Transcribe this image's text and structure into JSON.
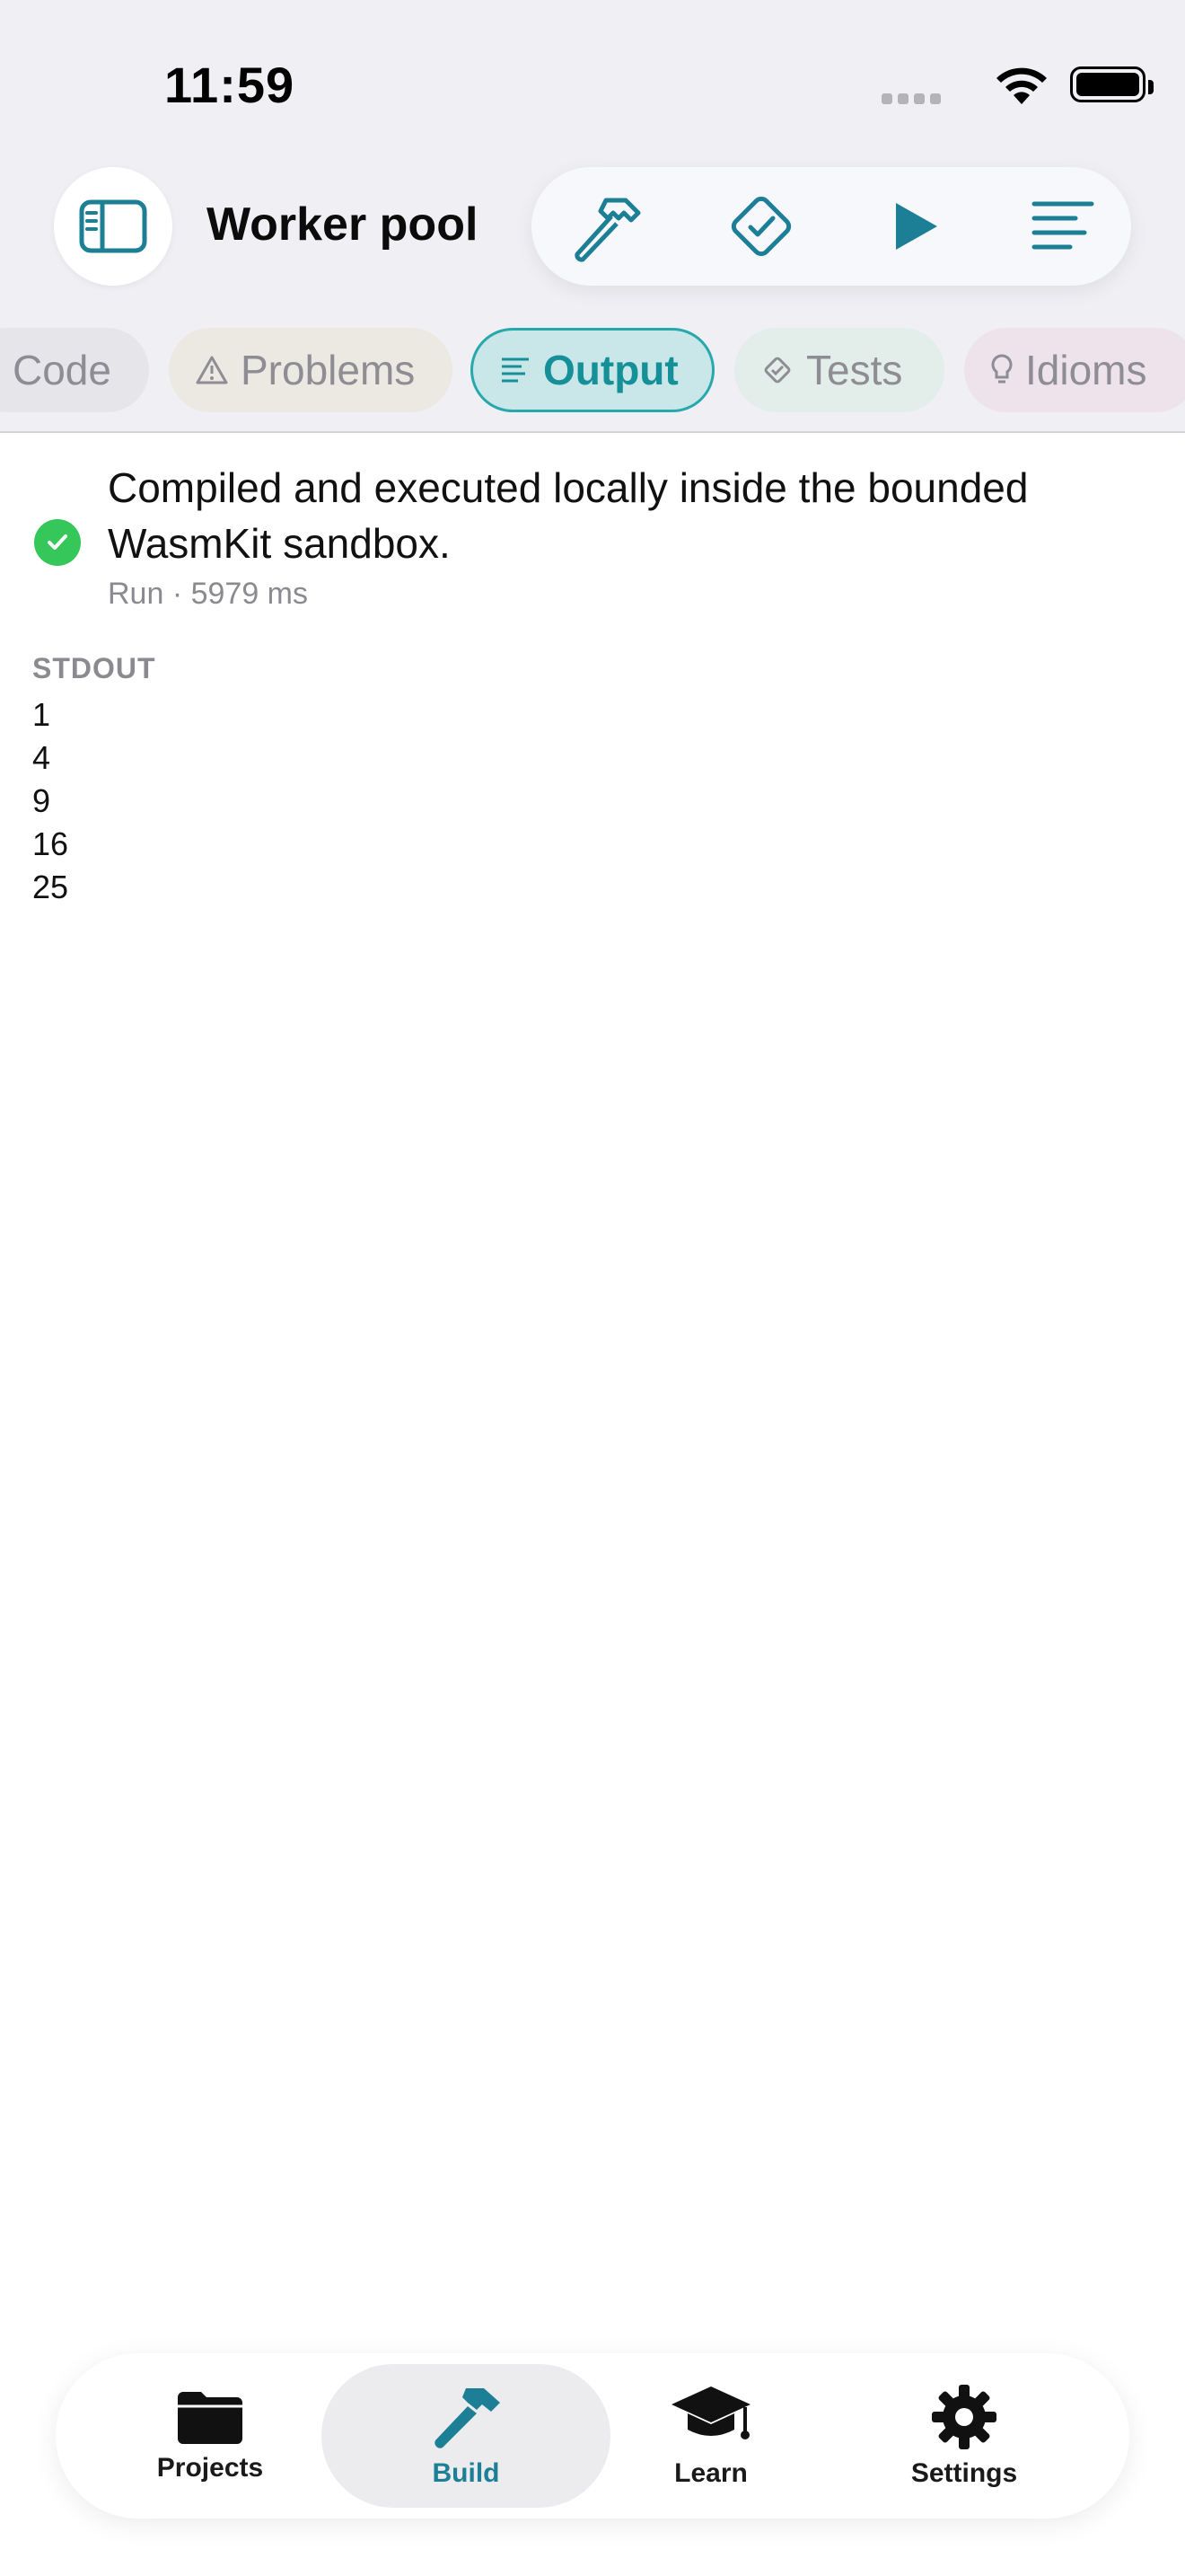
{
  "status_bar": {
    "time": "11:59"
  },
  "header": {
    "title": "Worker pool",
    "icons": {
      "sidebar": "sidebar-icon",
      "build": "hammer-icon",
      "check": "checkmark-diamond-icon",
      "run": "play-icon",
      "menu": "lines-icon"
    }
  },
  "tabs": [
    {
      "label": "Code",
      "icon": "code-icon"
    },
    {
      "label": "Problems",
      "icon": "warning-icon"
    },
    {
      "label": "Output",
      "icon": "text-lines-icon",
      "selected": true
    },
    {
      "label": "Tests",
      "icon": "diamond-check-icon"
    },
    {
      "label": "Idioms",
      "icon": "lightbulb-icon"
    }
  ],
  "output": {
    "message": "Compiled and executed locally inside the bounded WasmKit sandbox.",
    "meta": "Run · 5979 ms",
    "section_label": "STDOUT",
    "lines": [
      "1",
      "4",
      "9",
      "16",
      "25"
    ]
  },
  "tabbar": {
    "items": [
      {
        "label": "Projects",
        "icon": "folder-icon"
      },
      {
        "label": "Build",
        "icon": "hammer-icon",
        "selected": true
      },
      {
        "label": "Learn",
        "icon": "graduation-cap-icon"
      },
      {
        "label": "Settings",
        "icon": "gear-icon"
      }
    ]
  },
  "colors": {
    "accent": "#1d7f95",
    "success": "#35c759",
    "selected_tab_bg": "#c9e7e8",
    "selected_tab_text": "#158f98"
  }
}
